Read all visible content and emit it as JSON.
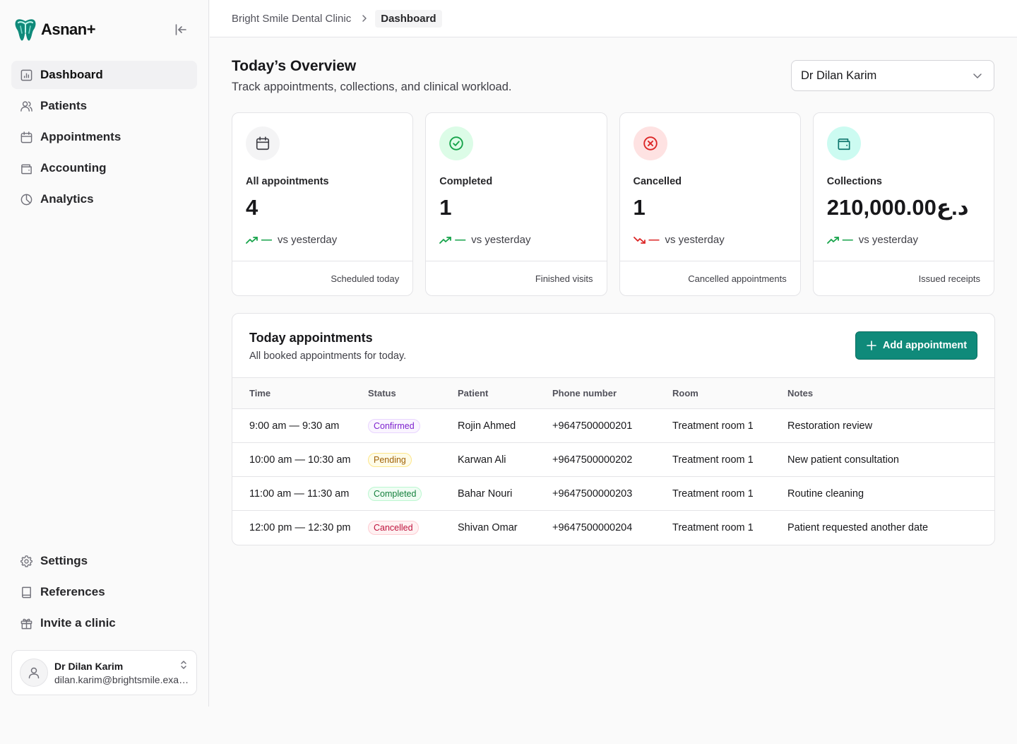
{
  "app": {
    "name": "Asnan+"
  },
  "colors": {
    "accent": "#0f8a7a",
    "success": "#16a34a",
    "danger": "#dc2626",
    "confirmed": "#7e22ce",
    "pending": "#a16207"
  },
  "sidebar": {
    "nav": [
      {
        "label": "Dashboard",
        "icon": "chart-icon",
        "active": true
      },
      {
        "label": "Patients",
        "icon": "users-icon"
      },
      {
        "label": "Appointments",
        "icon": "calendar-icon"
      },
      {
        "label": "Accounting",
        "icon": "wallet-icon"
      },
      {
        "label": "Analytics",
        "icon": "pie-chart-icon"
      }
    ],
    "bottom": [
      {
        "label": "Settings",
        "icon": "gear-icon"
      },
      {
        "label": "References",
        "icon": "book-icon"
      },
      {
        "label": "Invite a clinic",
        "icon": "gift-icon"
      }
    ],
    "user": {
      "name": "Dr Dilan Karim",
      "email": "dilan.karim@brightsmile.example"
    }
  },
  "breadcrumb": {
    "clinic": "Bright Smile Dental Clinic",
    "current": "Dashboard"
  },
  "header": {
    "title": "Today’s Overview",
    "subtitle": "Track appointments, collections, and clinical workload.",
    "doctor": "Dr Dilan Karim"
  },
  "stats": [
    {
      "label": "All appointments",
      "value": "4",
      "trend": "up",
      "dash": "—",
      "compare": "vs yesterday",
      "footer": "Scheduled today",
      "icon": "calendar-icon"
    },
    {
      "label": "Completed",
      "value": "1",
      "trend": "up",
      "dash": "—",
      "compare": "vs yesterday",
      "footer": "Finished visits",
      "icon": "check-circle-icon"
    },
    {
      "label": "Cancelled",
      "value": "1",
      "trend": "down",
      "dash": "—",
      "compare": "vs yesterday",
      "footer": "Cancelled appointments",
      "icon": "x-circle-icon"
    },
    {
      "label": "Collections",
      "value": "210,000.00د.ع",
      "trend": "up",
      "dash": "—",
      "compare": "vs yesterday",
      "footer": "Issued receipts",
      "icon": "wallet-icon"
    }
  ],
  "appointments": {
    "title": "Today appointments",
    "subtitle": "All booked appointments for today.",
    "add_label": "Add appointment",
    "columns": [
      "Time",
      "Status",
      "Patient",
      "Phone number",
      "Room",
      "Notes"
    ],
    "rows": [
      {
        "time": "9:00 am — 9:30 am",
        "status": "Confirmed",
        "patient": "Rojin Ahmed",
        "phone": "+9647500000201",
        "room": "Treatment room 1",
        "notes": "Restoration review"
      },
      {
        "time": "10:00 am — 10:30 am",
        "status": "Pending",
        "patient": "Karwan Ali",
        "phone": "+9647500000202",
        "room": "Treatment room 1",
        "notes": "New patient consultation"
      },
      {
        "time": "11:00 am — 11:30 am",
        "status": "Completed",
        "patient": "Bahar Nouri",
        "phone": "+9647500000203",
        "room": "Treatment room 1",
        "notes": "Routine cleaning"
      },
      {
        "time": "12:00 pm — 12:30 pm",
        "status": "Cancelled",
        "patient": "Shivan Omar",
        "phone": "+9647500000204",
        "room": "Treatment room 1",
        "notes": "Patient requested another date"
      }
    ]
  }
}
